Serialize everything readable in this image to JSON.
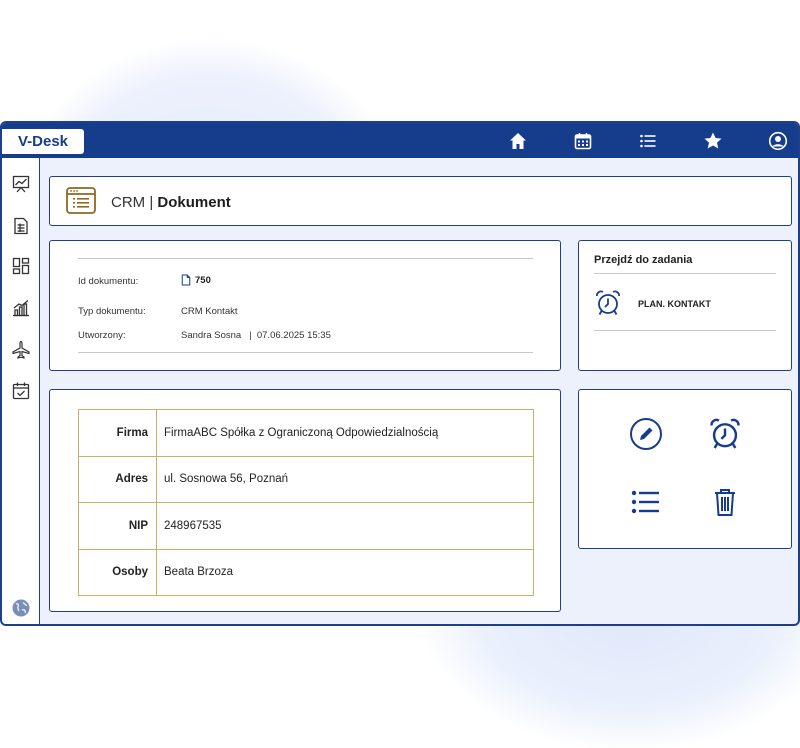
{
  "app": {
    "logo": "V-Desk"
  },
  "topbar": {
    "icons": [
      "home-icon",
      "calendar-icon",
      "list-icon",
      "star-icon",
      "user-icon"
    ]
  },
  "sidebar": {
    "icons": [
      "chart-board-icon",
      "document-icon",
      "dashboard-icon",
      "bar-chart-icon",
      "plane-icon",
      "calendar-check-icon",
      "globe-icon"
    ]
  },
  "header": {
    "module": "CRM |",
    "title": "Dokument"
  },
  "document": {
    "id_label": "Id dokumentu:",
    "id_value": "750",
    "type_label": "Typ dokumentu:",
    "type_value": "CRM Kontakt",
    "created_label": "Utworzony:",
    "created_by": "Sandra Sosna",
    "created_separator": "|",
    "created_at": "07.06.2025 15:35"
  },
  "task": {
    "title": "Przejdź do zadania",
    "item_label": "PLAN. KONTAKT"
  },
  "details": [
    {
      "key": "Firma",
      "value": "FirmaABC Spółka z Ograniczoną Odpowiedzialnością"
    },
    {
      "key": "Adres",
      "value": "ul. Sosnowa 56, Poznań"
    },
    {
      "key": "NIP",
      "value": "248967535"
    },
    {
      "key": "Osoby",
      "value": "Beata Brzoza"
    }
  ],
  "actions": [
    "edit-icon",
    "alarm-clock-icon",
    "list-icon",
    "trash-icon"
  ],
  "colors": {
    "primary": "#163c8c",
    "accent": "#8c6a1e",
    "background": "#edf1fc",
    "table_border": "#c9b06a"
  }
}
